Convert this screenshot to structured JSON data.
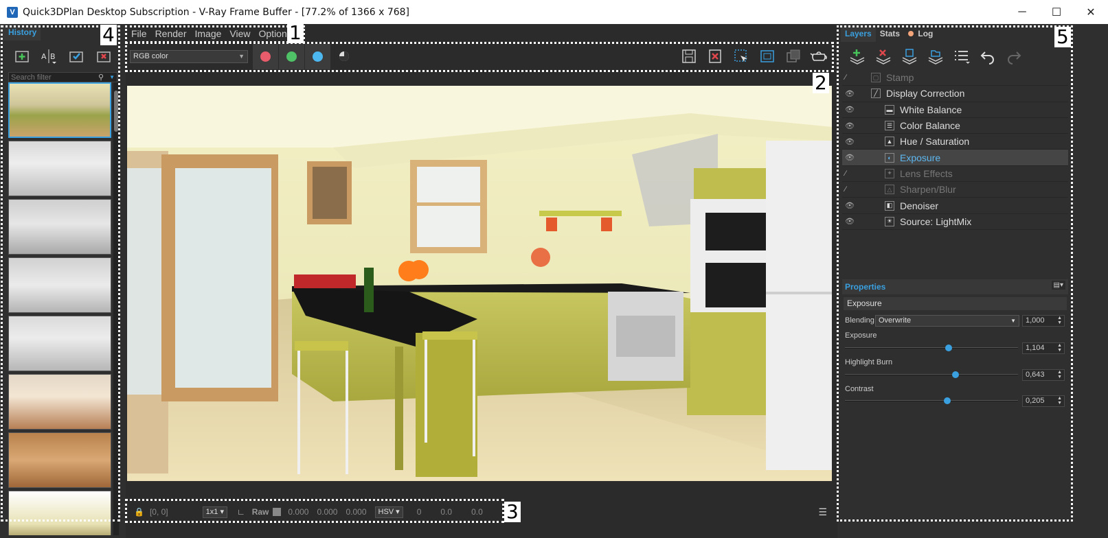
{
  "window": {
    "title": "Quick3DPlan Desktop Subscription - V-Ray Frame Buffer - [77.2% of 1366 x 768]",
    "minimize": "─",
    "maximize": "☐",
    "close": "✕"
  },
  "callouts": [
    "1",
    "2",
    "3",
    "4",
    "5"
  ],
  "history": {
    "tab_label": "History",
    "search_placeholder": "Search filter",
    "tools": [
      "add-to-history-icon",
      "ab-compare-icon",
      "load-image-icon",
      "remove-image-icon"
    ],
    "thumbnails": [
      "Kitchen render",
      "Island render",
      "Counter render",
      "Tall units render",
      "Cooktop render",
      "Window room render",
      "Wardrobe render",
      "Kitchen wide render"
    ]
  },
  "menu": [
    "File",
    "Render",
    "Image",
    "View",
    "Options"
  ],
  "toolbar": {
    "channel_select": "RGB color",
    "channels": [
      {
        "name": "red-channel",
        "color": "#e85c6b"
      },
      {
        "name": "green-channel",
        "color": "#4fc267"
      },
      {
        "name": "blue-channel",
        "color": "#4db8ef"
      }
    ],
    "right_tools": [
      "save-image-icon",
      "clear-image-icon",
      "region-render-icon",
      "track-mouse-icon",
      "duplicate-icon",
      "render-teapot-icon"
    ]
  },
  "status": {
    "coords": "[0, 0]",
    "zoom": "1x1",
    "raw_label": "Raw",
    "raw_values": [
      "0.000",
      "0.000",
      "0.000"
    ],
    "color_mode": "HSV",
    "hsv_values": [
      "0",
      "0.0",
      "0.0"
    ]
  },
  "right_panel": {
    "tabs": {
      "layers": "Layers",
      "stats": "Stats",
      "log": "Log"
    },
    "layers": [
      {
        "label": "Stamp",
        "visible": false,
        "dim": true,
        "indent": 0
      },
      {
        "label": "Display Correction",
        "visible": true,
        "dim": false,
        "indent": 0
      },
      {
        "label": "White Balance",
        "visible": true,
        "dim": false,
        "indent": 1
      },
      {
        "label": "Color Balance",
        "visible": true,
        "dim": false,
        "indent": 1
      },
      {
        "label": "Hue / Saturation",
        "visible": true,
        "dim": false,
        "indent": 1
      },
      {
        "label": "Exposure",
        "visible": true,
        "dim": false,
        "indent": 1,
        "selected": true
      },
      {
        "label": "Lens Effects",
        "visible": false,
        "dim": true,
        "indent": 1
      },
      {
        "label": "Sharpen/Blur",
        "visible": false,
        "dim": true,
        "indent": 1
      },
      {
        "label": "Denoiser",
        "visible": true,
        "dim": false,
        "indent": 1
      },
      {
        "label": "Source: LightMix",
        "visible": true,
        "dim": false,
        "indent": 1
      }
    ],
    "properties": {
      "header": "Properties",
      "layer_name": "Exposure",
      "blending_label": "Blending",
      "blending_mode": "Overwrite",
      "blending_value": "1,000",
      "exposure_label": "Exposure",
      "exposure_value": "1,104",
      "exposure_level": 0.6,
      "highlight_label": "Highlight Burn",
      "highlight_value": "0,643",
      "highlight_level": 0.64,
      "contrast_label": "Contrast",
      "contrast_value": "0,205",
      "contrast_level": 0.59
    }
  }
}
